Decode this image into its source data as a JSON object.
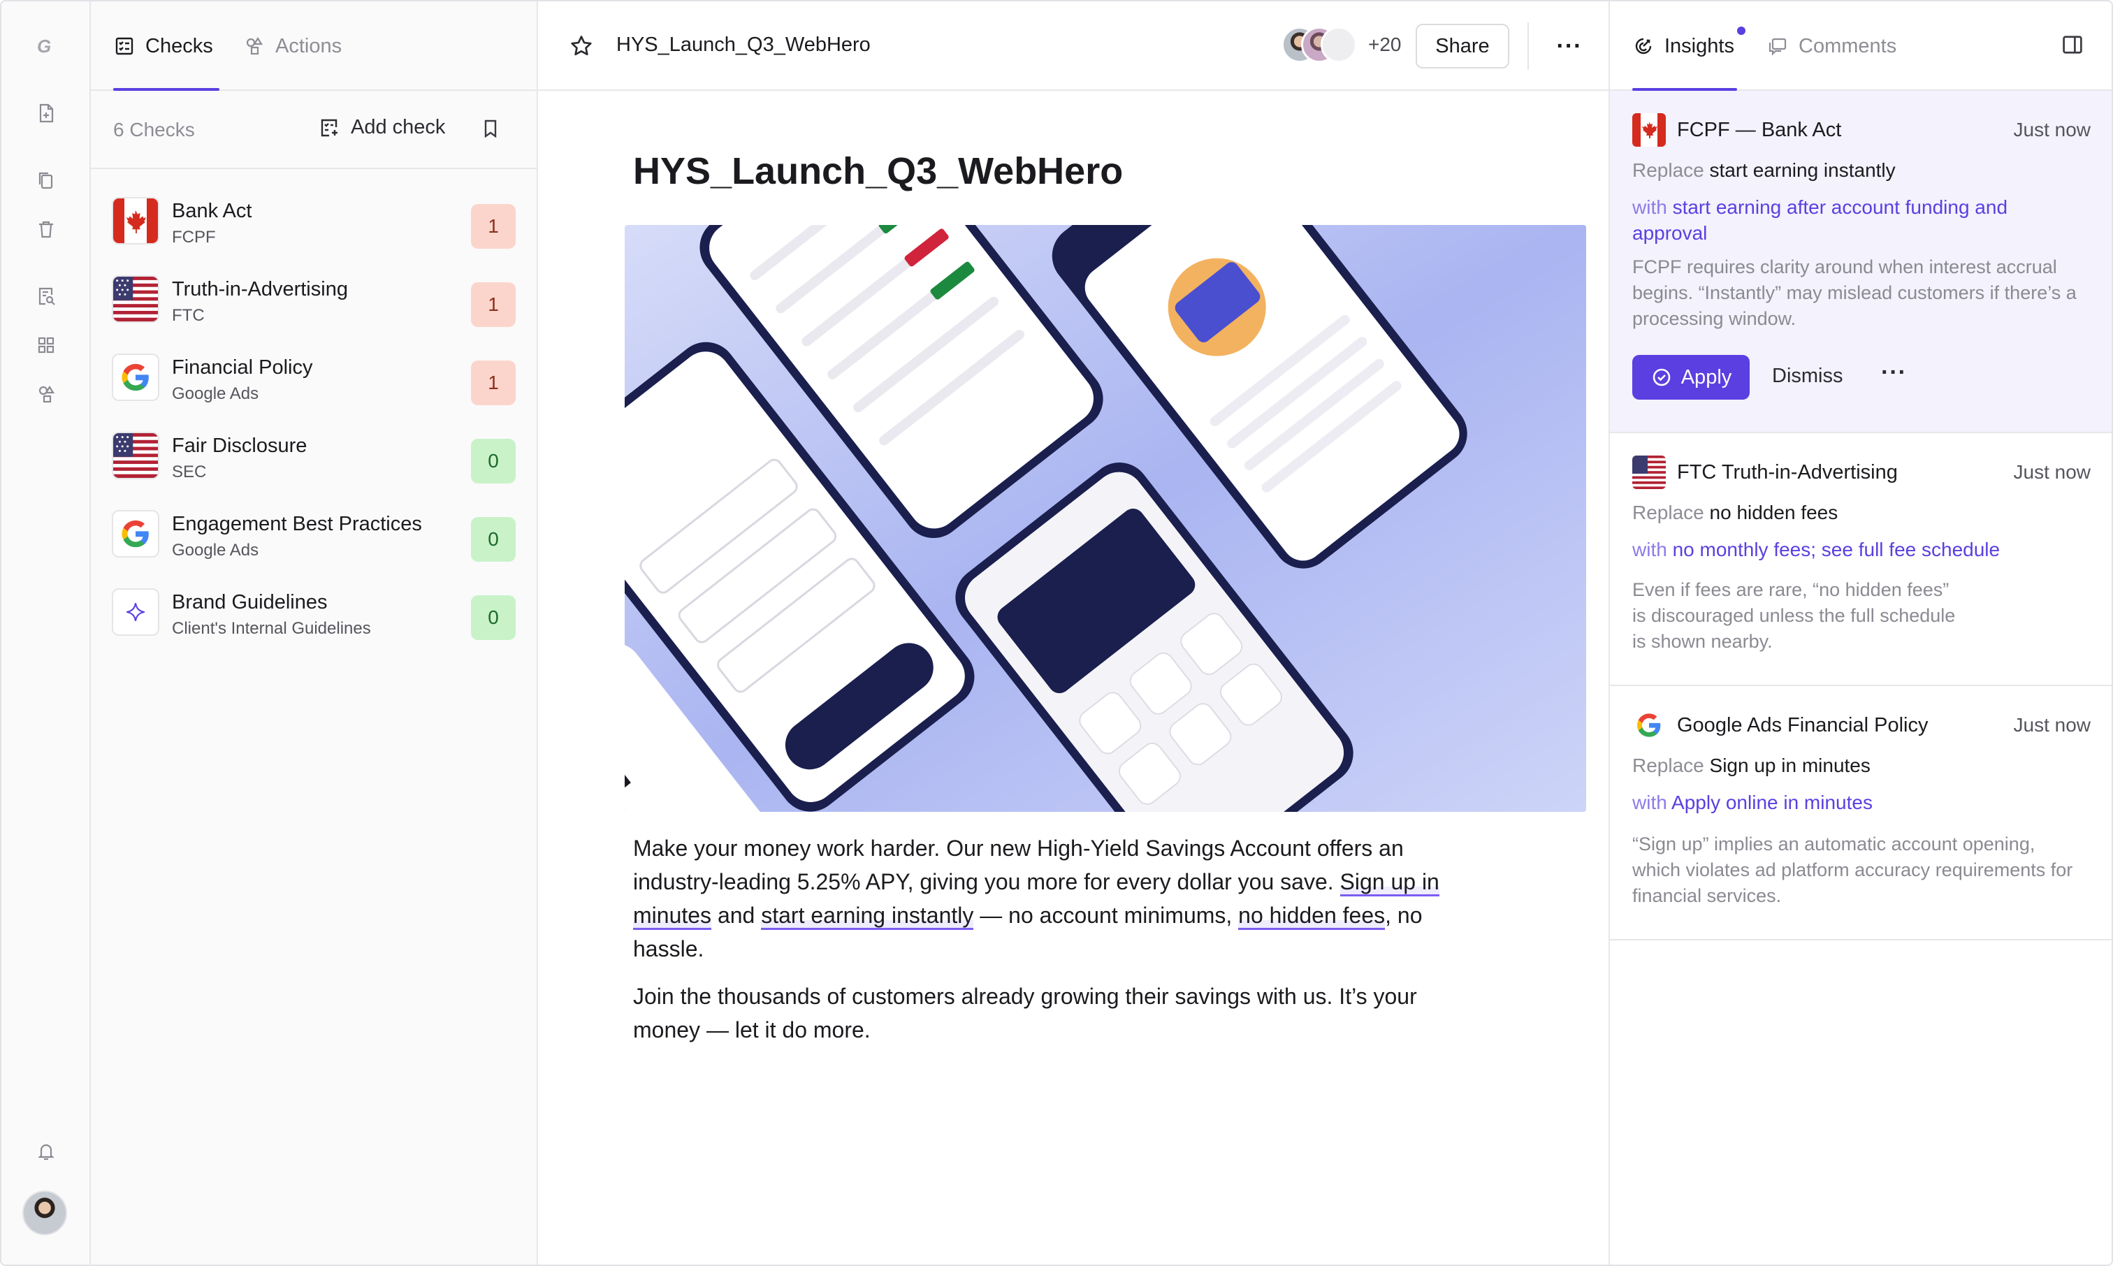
{
  "rail": {
    "icons": [
      "logo-icon",
      "new-doc-icon",
      "copy-icon",
      "trash-icon",
      "search-doc-icon",
      "grid-icon",
      "shapes-icon",
      "bell-icon"
    ]
  },
  "checks_panel": {
    "tabs": [
      {
        "label": "Checks"
      },
      {
        "label": "Actions"
      }
    ],
    "count_label": "6 Checks",
    "add_label": "Add check",
    "items": [
      {
        "name": "Bank Act",
        "source": "FCPF",
        "count": "1",
        "logo": "canada-flag"
      },
      {
        "name": "Truth-in-Advertising",
        "source": "FTC",
        "count": "1",
        "logo": "us-flag"
      },
      {
        "name": "Financial Policy",
        "source": "Google Ads",
        "count": "1",
        "logo": "google-logo"
      },
      {
        "name": "Fair Disclosure",
        "source": "SEC",
        "count": "0",
        "logo": "us-flag"
      },
      {
        "name": "Engagement Best Practices",
        "source": "Google Ads",
        "count": "0",
        "logo": "google-logo"
      },
      {
        "name": "Brand Guidelines",
        "source": "Client's Internal Guidelines",
        "count": "0",
        "logo": "sparkle-logo"
      }
    ],
    "colors": {
      "badge_red": "#fbd5cc",
      "badge_green": "#c9f2c9"
    }
  },
  "document": {
    "filename": "HYS_Launch_Q3_WebHero",
    "collaborators_extra": "+20",
    "share_label": "Share",
    "title": "HYS_Launch_Q3_WebHero",
    "para1_a": "Make your money work harder. Our new High-Yield Savings Account offers an industry-leading 5.25% APY, giving you more for every dollar you save.",
    "para1_hl1": "Sign up in minutes",
    "para1_b": "and",
    "para1_hl2": "start earning instantly",
    "para1_c": "— no account minimums,",
    "para1_hl3": "no hidden fees",
    "para1_d": ", no hassle.",
    "para2": "Join the thousands of customers already growing their savings with us. It’s your money — let it do more."
  },
  "insights_panel": {
    "tabs": [
      {
        "label": "Insights"
      },
      {
        "label": "Comments"
      }
    ],
    "accent": "#5b3fe0",
    "cards": [
      {
        "title": "FCPF — Bank Act",
        "time": "Just now",
        "replace_kw": "Replace",
        "replace_text": "start earning instantly",
        "with_kw": "with",
        "with_text": "start earning after account funding and approval",
        "explanation": "FCPF requires clarity around when interest accrual begins. “Instantly” may mislead customers if there’s a processing window.",
        "apply_label": "Apply",
        "dismiss_label": "Dismiss"
      },
      {
        "title": "FTC Truth-in-Advertising",
        "time": "Just now",
        "replace_kw": "Replace",
        "replace_text": "no hidden fees",
        "with_kw": "with",
        "with_text": "no monthly fees; see full fee schedule",
        "explanation": "Even if fees are rare, “no hidden fees” is discouraged unless the full schedule is shown nearby."
      },
      {
        "title": "Google Ads Financial Policy",
        "time": "Just now",
        "replace_kw": "Replace",
        "replace_text": "Sign up in minutes",
        "with_kw": "with",
        "with_text": "Apply online in minutes",
        "explanation": "“Sign up” implies an automatic account opening, which violates ad platform accuracy requirements for financial services."
      }
    ]
  }
}
